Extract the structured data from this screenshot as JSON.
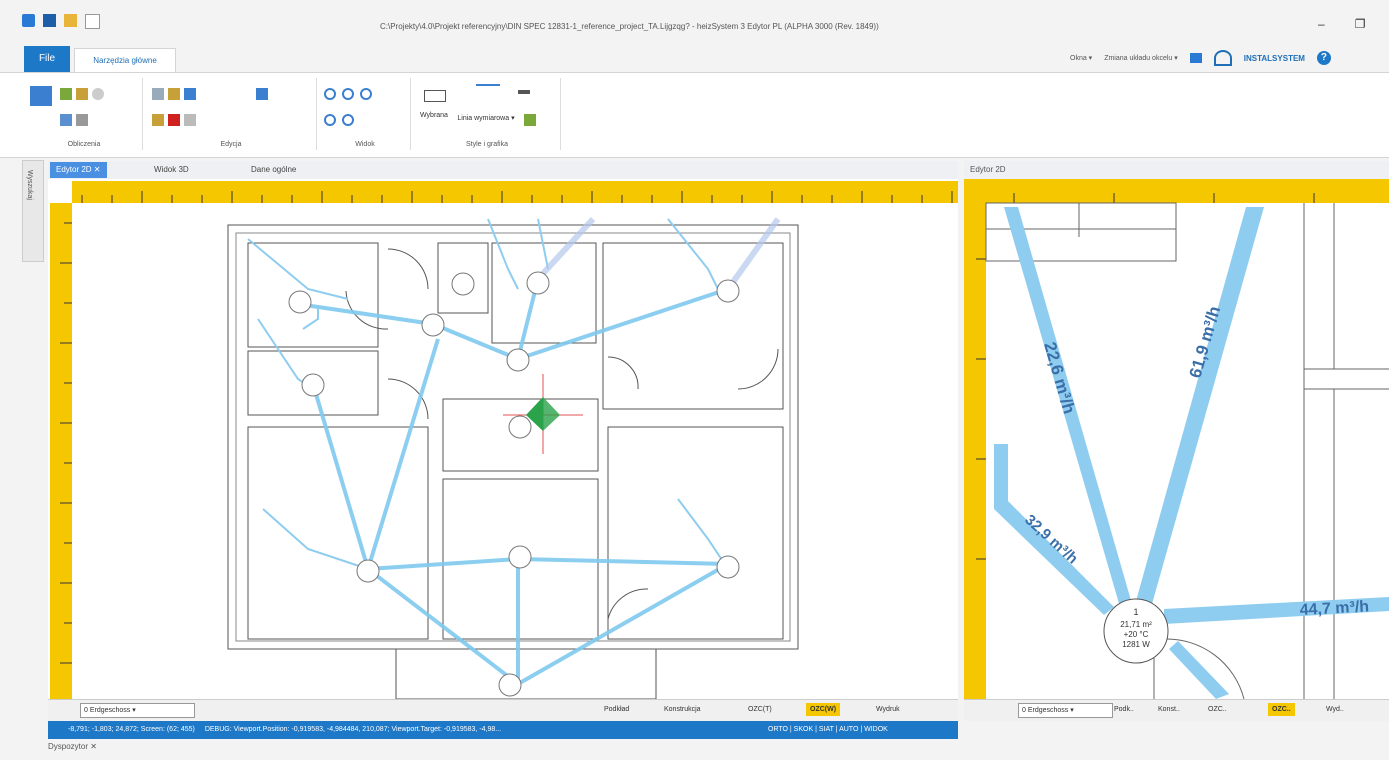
{
  "window": {
    "title": "C:\\Projekty\\4.0\\Projekt referencyjny\\DIN SPEC 12831-1_reference_project_TA.Lijgzqg? - heizSystem 3 Edytor PL (ALPHA 3000 (Rev. 1849))",
    "minimize": "–",
    "maximize": "❐"
  },
  "ribbon": {
    "file_tab": "File",
    "home_tab": "Narzędzia główne",
    "right_menu": [
      "Okna ▾",
      "Zmiana układu okcelu ▾"
    ],
    "brand": "INSTALSYSTEM",
    "help": "?",
    "groups": [
      {
        "label": "Obliczenia"
      },
      {
        "label": "Edycja"
      },
      {
        "label": "Widok"
      },
      {
        "label": "Style i grafika"
      }
    ],
    "group4_items": [
      "Wybrana",
      "Linia wymiarowa ▾"
    ]
  },
  "sidebar": {
    "label": "Wyszukaj"
  },
  "doc_tabs": [
    {
      "label": "Edytor 2D ✕"
    },
    {
      "label": "Widok 3D"
    },
    {
      "label": "Dane ogólne"
    }
  ],
  "right_view": {
    "title": "Edytor 2D"
  },
  "plan_right": {
    "labels": [
      {
        "text": "22,6 m³/h"
      },
      {
        "text": "61,9 m³/h"
      },
      {
        "text": "32,9 m³/h"
      },
      {
        "text": "44,7 m³/h"
      }
    ],
    "node_info": [
      "1",
      "21,71 m²",
      "+20 °C",
      "1281 W"
    ]
  },
  "bottom_bar_left": {
    "level": "0 Erdgeschoss ▾",
    "tabs": [
      "Podkład",
      "Konstrukcja",
      "OZC(T)",
      "OZC(W)",
      "Wydruk"
    ],
    "active": "OZC(W)"
  },
  "bottom_bar_right": {
    "level": "0 Erdgeschoss ▾",
    "tabs": [
      "Podk..",
      "Konst..",
      "OZC..",
      "OZC..",
      "Wyd.."
    ],
    "active": "OZC.."
  },
  "status": {
    "coords": "-8,791; -1,803; 24,872; Screen: (62; 455)",
    "debug": "DEBUG: Viewport.Position: -0,919583, -4,984484, 210,087; Viewport.Target: -0,919583, -4,98...",
    "modes": "ORTO | SKOK | SIAT | AUTO | WIDOK"
  },
  "bottom_panel": {
    "label": "Dyspozytor ✕"
  }
}
